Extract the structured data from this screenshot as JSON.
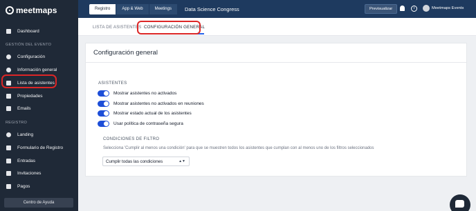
{
  "brand": {
    "name": "meetmaps"
  },
  "sidebar": {
    "dashboard": "Dashboard",
    "section_event": "GESTIÓN DEL EVENTO",
    "event_items": [
      {
        "label": "Configuración",
        "icon": "gear-icon"
      },
      {
        "label": "Información general",
        "icon": "info-icon"
      },
      {
        "label": "Lista de asistentes",
        "icon": "users-icon"
      },
      {
        "label": "Propiedades",
        "icon": "tag-icon"
      },
      {
        "label": "Emails",
        "icon": "mail-icon"
      }
    ],
    "section_registro": "REGISTRO",
    "registro_items": [
      {
        "label": "Landing",
        "icon": "globe-icon"
      },
      {
        "label": "Formulario de Registro",
        "icon": "form-icon"
      },
      {
        "label": "Entradas",
        "icon": "ticket-icon"
      },
      {
        "label": "Invitaciones",
        "icon": "envelope-icon"
      },
      {
        "label": "Pagos",
        "icon": "card-icon"
      }
    ],
    "help": "Centro de Ayuda"
  },
  "topbar": {
    "tabs": [
      "Registro",
      "App & Web",
      "Meetings"
    ],
    "active_tab": "Registro",
    "event_title": "Data Science Congress",
    "preview": "Previsualizar",
    "user": "Meetmaps Events"
  },
  "subtabs": {
    "list": "LISTA DE ASISTENTES",
    "config": "CONFIGURACIÓN GENERAL"
  },
  "card": {
    "title": "Configuración general",
    "section": "ASISTENTES",
    "toggles": [
      {
        "label": "Mostrar asistentes no activados",
        "on": true
      },
      {
        "label": "Mostrar asistentes no activados en reuniones",
        "on": true
      },
      {
        "label": "Mostrar estado actual de los asistentes",
        "on": true
      },
      {
        "label": "Usar política de contraseña segura",
        "on": true
      }
    ],
    "filter_title": "CONDICIONES DE FILTRO",
    "filter_desc": "Selecciona 'Cumplir al menos una condición' para que se muestren todos los asistentes que cumplan con al menos uno de los filtros seleccionados",
    "filter_value": "Cumplir todas las condiciones"
  },
  "colors": {
    "sidebar": "#1f2937",
    "topbar": "#1e3a5f",
    "toggle": "#1d4ed8",
    "highlight": "#dc2626"
  }
}
